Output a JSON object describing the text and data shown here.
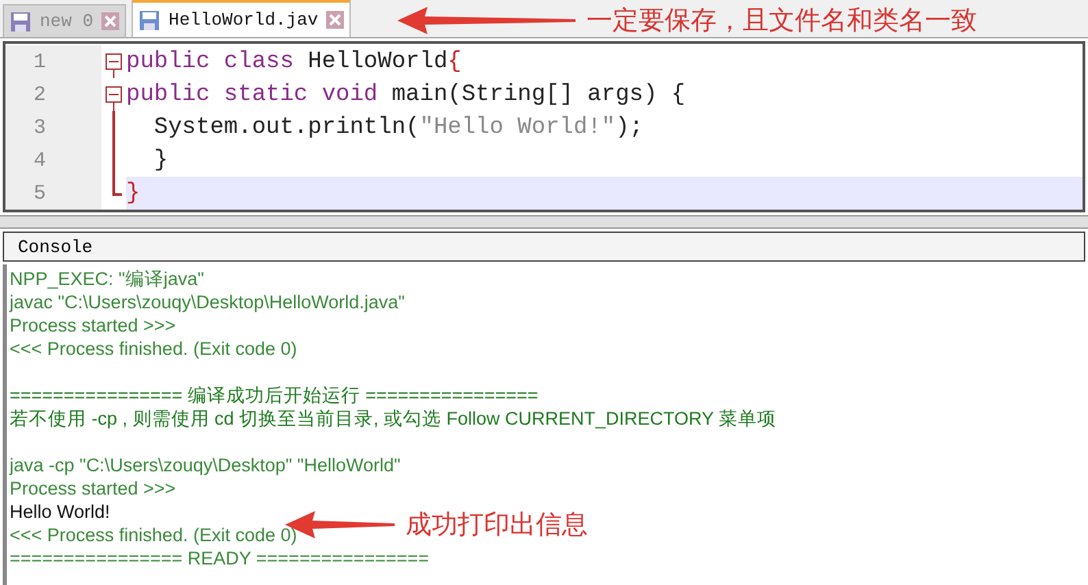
{
  "tabs": [
    {
      "label": "new 0",
      "selected": false
    },
    {
      "label": "HelloWorld.jav",
      "selected": true
    }
  ],
  "editor": {
    "lines": [
      {
        "number": "1",
        "foldable": true,
        "current": false,
        "tokens": [
          {
            "text": "public class ",
            "kind": "keyword"
          },
          {
            "text": "HelloWorld",
            "kind": "plain"
          },
          {
            "text": "{",
            "kind": "brace"
          }
        ]
      },
      {
        "number": "2",
        "foldable": true,
        "current": false,
        "tokens": [
          {
            "text": "public static void ",
            "kind": "keyword"
          },
          {
            "text": "main(String[] args) {",
            "kind": "plain"
          }
        ]
      },
      {
        "number": "3",
        "foldable": false,
        "current": false,
        "tokens": [
          {
            "text": "  System.out.println(",
            "kind": "plain"
          },
          {
            "text": "\"Hello World!\"",
            "kind": "string"
          },
          {
            "text": ");",
            "kind": "plain"
          }
        ]
      },
      {
        "number": "4",
        "foldable": false,
        "current": false,
        "tokens": [
          {
            "text": "  }",
            "kind": "plain"
          }
        ]
      },
      {
        "number": "5",
        "foldable": false,
        "current": true,
        "tokens": [
          {
            "text": "}",
            "kind": "brace"
          }
        ]
      }
    ]
  },
  "console": {
    "title": "Console",
    "lines": [
      {
        "text": "NPP_EXEC: \"编译java\"",
        "kind": "info"
      },
      {
        "text": "javac \"C:\\Users\\zouqy\\Desktop\\HelloWorld.java\"",
        "kind": "info"
      },
      {
        "text": "Process started >>>",
        "kind": "info"
      },
      {
        "text": "<<< Process finished. (Exit code 0)",
        "kind": "info"
      },
      {
        "kind": "blank"
      },
      {
        "text": "================ 编译成功后开始运行 ================",
        "kind": "note"
      },
      {
        "text": "若不使用 -cp , 则需使用 cd 切换至当前目录, 或勾选 Follow CURRENT_DIRECTORY 菜单项",
        "kind": "note"
      },
      {
        "kind": "blank"
      },
      {
        "text": "java -cp \"C:\\Users\\zouqy\\Desktop\" \"HelloWorld\"",
        "kind": "info"
      },
      {
        "text": "Process started >>>",
        "kind": "info"
      },
      {
        "text": "Hello World!",
        "kind": "output"
      },
      {
        "text": "<<< Process finished. (Exit code 0)",
        "kind": "info"
      },
      {
        "text": "================ READY ================",
        "kind": "info"
      }
    ]
  },
  "annotations": [
    {
      "text": "一定要保存，且文件名和类名一致"
    },
    {
      "text": "成功打印出信息"
    }
  ]
}
